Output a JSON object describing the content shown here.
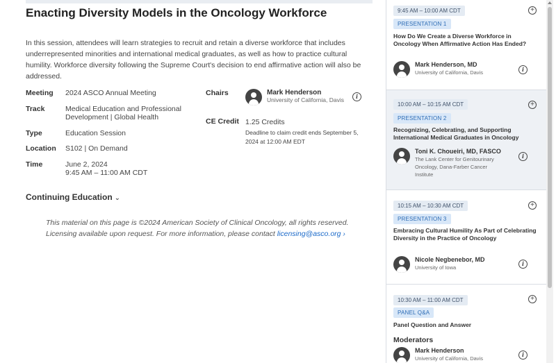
{
  "session": {
    "title": "Enacting Diversity Models in the Oncology Workforce",
    "description": "In this session, attendees will learn strategies to recruit and retain a diverse workforce that includes underrepresented minorities and international medical graduates, as well as how to practice cultural humility. Workforce diversity following the Supreme Court's decision to end affirmative action will also be addressed."
  },
  "meta": [
    {
      "label": "Meeting",
      "value": "2024 ASCO Annual Meeting"
    },
    {
      "label": "Track",
      "value": "Medical Education and Professional Development | Global Health"
    },
    {
      "label": "Type",
      "value": "Education Session"
    },
    {
      "label": "Location",
      "value": "S102 | On Demand"
    },
    {
      "label": "Time",
      "value": "June 2, 2024",
      "value2": "9:45 AM – 11:00 AM CDT"
    }
  ],
  "chairs": {
    "label": "Chairs",
    "name": "Mark Henderson",
    "org": "University of California, Davis"
  },
  "ce": {
    "label": "CE Credit",
    "credits": "1.25 Credits",
    "deadline": "Deadline to claim credit ends September 5, 2024 at 12:00 AM EDT"
  },
  "continuing_education": {
    "label": "Continuing Education",
    "chevron": "⌄"
  },
  "license": {
    "text": "This material on this page is ©2024 American Society of Clinical Oncology, all rights reserved. Licensing available upon request. For more information, please contact ",
    "link": "licensing@asco.org ›"
  },
  "schedule": [
    {
      "time": "9:45 AM – 10:00 AM CDT",
      "tag": "PRESENTATION 1",
      "title": "How Do We Create a Diverse Workforce in Oncology When Affirmative Action Has Ended?",
      "speaker": "Mark Henderson, MD",
      "org": "University of California, Davis"
    },
    {
      "time": "10:00 AM – 10:15 AM CDT",
      "tag": "PRESENTATION 2",
      "title": "Recognizing, Celebrating, and Supporting International Medical Graduates in Oncology",
      "speaker": "Toni K. Choueiri, MD, FASCO",
      "org": "The Lank Center for Genitourinary Oncology, Dana-Farber Cancer Institute"
    },
    {
      "time": "10:15 AM – 10:30 AM CDT",
      "tag": "PRESENTATION 3",
      "title": "Embracing Cultural Humility As Part of Celebrating Diversity in the Practice of Oncology",
      "speaker": "Nicole Negbenebor, MD",
      "org": "University of Iowa"
    },
    {
      "time": "10:30 AM – 11:00 AM CDT",
      "tag": "PANEL Q&A",
      "title": "Panel Question and Answer",
      "moderators_label": "Moderators",
      "speaker": "Mark Henderson",
      "org": "University of California, Davis"
    }
  ],
  "icons": {
    "plus": "+",
    "info": "i"
  }
}
